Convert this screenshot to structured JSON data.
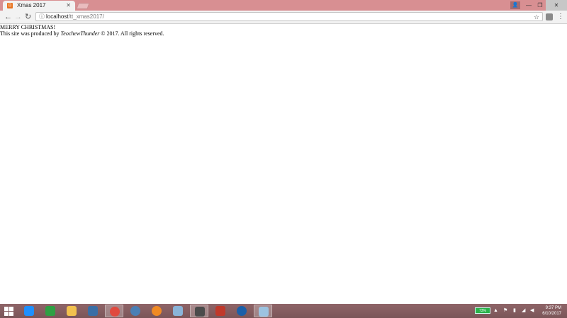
{
  "browser": {
    "tab": {
      "title": "Xmas 2017",
      "close_glyph": "✕",
      "favicon_letter": "⊡"
    },
    "window_controls": {
      "user": "👤",
      "minimize": "—",
      "maximize": "❐",
      "close": "✕"
    },
    "toolbar": {
      "back": "←",
      "forward": "→",
      "reload": "↻",
      "info_icon": "ⓘ",
      "url_host": "localhost",
      "url_path": "/tt_xmas2017/",
      "star": "☆",
      "menu": "⋮"
    }
  },
  "page": {
    "heading": "MERRY CHRISTMAS!",
    "credit_prefix": "This site was produced by ",
    "credit_author": "TeochewThunder",
    "credit_suffix": " © 2017. All rights reserved."
  },
  "taskbar": {
    "apps": [
      {
        "name": "internet-explorer",
        "color": "#1e90ff"
      },
      {
        "name": "windows-store",
        "color": "#2ea043"
      },
      {
        "name": "file-explorer",
        "color": "#f2c14e"
      },
      {
        "name": "remote-desktop",
        "color": "#3a6ea5"
      },
      {
        "name": "chrome",
        "color": "#e04a3f"
      },
      {
        "name": "globe-app",
        "color": "#4a7fb5"
      },
      {
        "name": "firefox",
        "color": "#f08a24"
      },
      {
        "name": "notepad-plus",
        "color": "#8ab4d8"
      },
      {
        "name": "sublime-text",
        "color": "#4b4b4b"
      },
      {
        "name": "filezilla",
        "color": "#c0392b"
      },
      {
        "name": "sourcetree",
        "color": "#1b5fa8"
      },
      {
        "name": "app-blue",
        "color": "#9cc3e0"
      }
    ],
    "battery_percent": "73%",
    "clock_time": "9:37 PM",
    "clock_date": "6/10/2017"
  }
}
